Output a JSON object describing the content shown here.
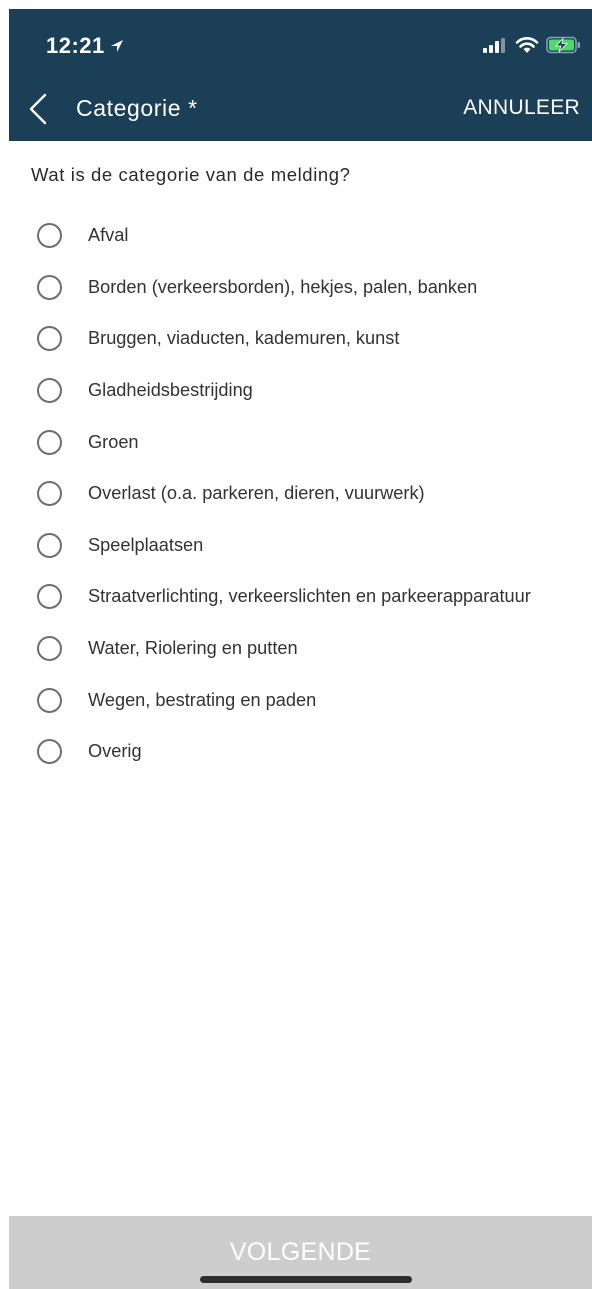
{
  "status_bar": {
    "time": "12:21"
  },
  "nav": {
    "title": "Categorie *",
    "cancel_label": "ANNULEER"
  },
  "question": "Wat is de categorie van de melding?",
  "options": [
    "Afval",
    "Borden (verkeersborden), hekjes, palen, banken",
    "Bruggen, viaducten, kademuren, kunst",
    "Gladheidsbestrijding",
    "Groen",
    "Overlast (o.a. parkeren, dieren, vuurwerk)",
    "Speelplaatsen",
    "Straatverlichting, verkeerslichten en parkeerapparatuur",
    "Water, Riolering en putten",
    "Wegen, bestrating en paden",
    "Overig"
  ],
  "footer": {
    "next_label": "VOLGENDE"
  },
  "colors": {
    "header_bg": "#1b3f57",
    "battery_charging": "#4cd964",
    "button_disabled_bg": "#cdcdcd"
  },
  "icons": {
    "location": "location-arrow-icon",
    "signal": "cellular-signal-icon",
    "wifi": "wifi-icon",
    "battery": "battery-charging-icon",
    "back": "chevron-left-icon",
    "radio": "radio-unchecked-icon"
  }
}
